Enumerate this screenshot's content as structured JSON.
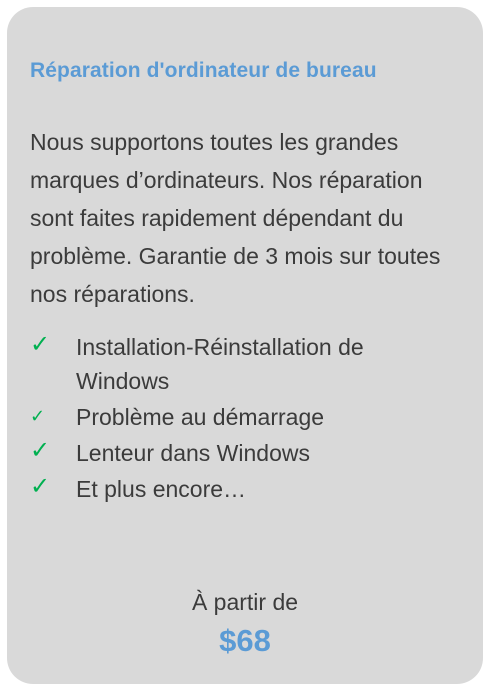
{
  "card": {
    "title": "Réparation d'ordinateur de bureau",
    "description": "Nous supportons toutes les grandes marques d’ordinateurs.  Nos réparation sont faites rapidement dépendant du problème.  Garantie de 3 mois sur toutes nos réparations.",
    "features": [
      {
        "icon": "check-icon",
        "text": "Installation-Réinstallation de Windows"
      },
      {
        "icon": "check-icon",
        "text": "Problème au démarrage"
      },
      {
        "icon": "check-icon",
        "text": "Lenteur dans Windows"
      },
      {
        "icon": "check-icon",
        "text": "Et plus encore…"
      }
    ],
    "price_label": "À partir de",
    "price": "$68"
  },
  "colors": {
    "card_background": "#d9d9d9",
    "accent_blue": "#5b9bd5",
    "check_green": "#00b050",
    "body_text": "#3b3b3b"
  }
}
